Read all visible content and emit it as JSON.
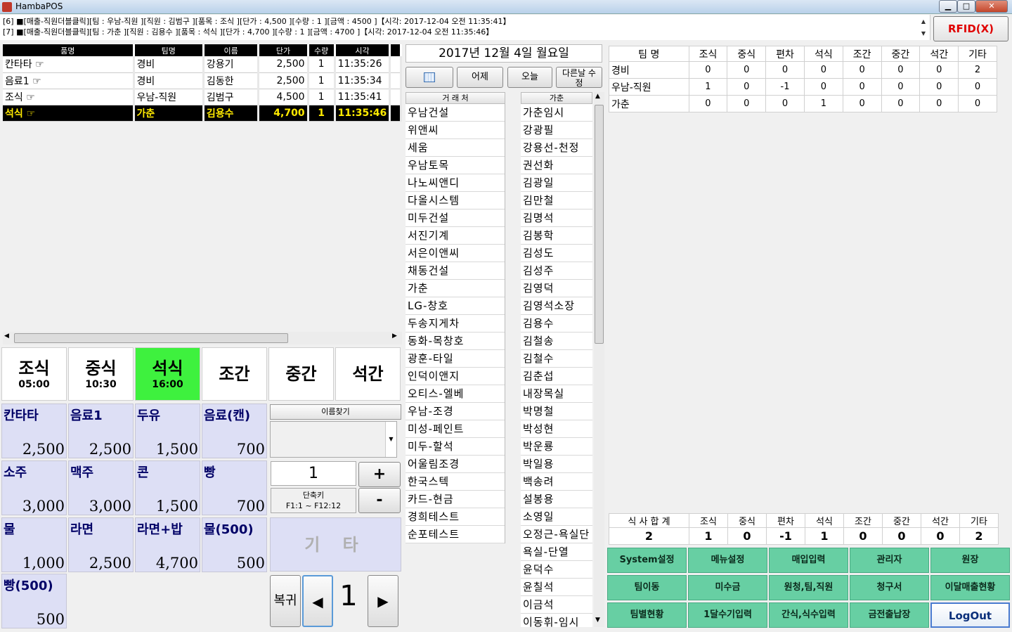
{
  "window": {
    "title": "HambaPOS",
    "buttons": [
      "▁",
      "□",
      "✕"
    ]
  },
  "log": {
    "lines": [
      "[6] ■[매출-직원더블클릭][팀 : 우남-직원 ][직원 : 김범구 ][품목 : 조식 ][단가 : 4,500 ][수량 : 1 ][금액 : 4500 ]【시각: 2017-12-04 오전 11:35:41】",
      "[7] ■[매출-직원더블클릭][팀 : 가춘 ][직원 : 김용수 ][품목 : 석식 ][단가 : 4,700 ][수량 : 1 ][금액 : 4700 ]【시각: 2017-12-04 오전 11:35:46】"
    ]
  },
  "rfid_label": "RFID(X)",
  "order_table": {
    "headers": [
      "품명",
      "팀명",
      "이름",
      "단가",
      "수량",
      "시각"
    ],
    "rows": [
      {
        "item": "칸타타 ☞",
        "team": "경비",
        "name": "강용기",
        "price": "2,500",
        "qty": "1",
        "time": "11:35:26"
      },
      {
        "item": "음료1 ☞",
        "team": "경비",
        "name": "김동한",
        "price": "2,500",
        "qty": "1",
        "time": "11:35:34"
      },
      {
        "item": "조식 ☞",
        "team": "우남-직원",
        "name": "김범구",
        "price": "4,500",
        "qty": "1",
        "time": "11:35:41"
      },
      {
        "item": "석식 ☞",
        "team": "가춘",
        "name": "김용수",
        "price": "4,700",
        "qty": "1",
        "time": "11:35:46"
      }
    ]
  },
  "meals": [
    {
      "name": "조식",
      "time": "05:00"
    },
    {
      "name": "중식",
      "time": "10:30"
    },
    {
      "name": "석식",
      "time": "16:00"
    },
    {
      "name": "조간",
      "time": ""
    },
    {
      "name": "중간",
      "time": ""
    },
    {
      "name": "석간",
      "time": ""
    }
  ],
  "menu_items": [
    {
      "name": "칸타타",
      "price": "2,500"
    },
    {
      "name": "음료1",
      "price": "2,500"
    },
    {
      "name": "두유",
      "price": "1,500"
    },
    {
      "name": "음료(캔)",
      "price": "700"
    },
    {
      "name": "소주",
      "price": "3,000"
    },
    {
      "name": "맥주",
      "price": "3,000"
    },
    {
      "name": "콘",
      "price": "1,500"
    },
    {
      "name": "빵",
      "price": "700"
    },
    {
      "name": "물",
      "price": "1,000"
    },
    {
      "name": "라면",
      "price": "2,500"
    },
    {
      "name": "라면+밥",
      "price": "4,700"
    },
    {
      "name": "물(500)",
      "price": "500"
    },
    {
      "name": "빵(500)",
      "price": "500"
    }
  ],
  "controls": {
    "etc": "기 타",
    "find_name": "이름찾기",
    "quantity": "1",
    "plus": "+",
    "minus": "-",
    "shortcut_title": "단축키",
    "shortcut_range": "F1:1 ~ F12:12",
    "return": "복귀",
    "prev": "◀",
    "next": "▶",
    "page": "1"
  },
  "date_panel": {
    "date": "2017년  12월  4일  월요일",
    "yesterday": "어제",
    "today": "오늘",
    "other_day": "다른날 수  정"
  },
  "clients": {
    "header": "거 래 처",
    "items": [
      "우남건설",
      "위앤씨",
      "세움",
      "우남토목",
      "나노씨앤디",
      "다올시스템",
      "미두건설",
      "서진기계",
      "서은이앤씨",
      "채동건설",
      "가춘",
      "LG-창호",
      "두송지게차",
      "동화-목창호",
      "광훈-타일",
      "인덕이앤지",
      "오티스-엘베",
      "우남-조경",
      "미성-페인트",
      "미두-할석",
      "어울림조경",
      "한국스텍",
      "카드-현금",
      "경희테스트",
      "순포테스트"
    ]
  },
  "employees": {
    "header": "가춘",
    "items": [
      "가춘임시",
      "강광필",
      "강용선-천정",
      "권선화",
      "김광일",
      "김만철",
      "김명석",
      "김봉학",
      "김성도",
      "김성주",
      "김영덕",
      "김영석소장",
      "김용수",
      "김철송",
      "김철수",
      "김춘섭",
      "내장목실",
      "박명철",
      "박성현",
      "박운룡",
      "박일용",
      "백송려",
      "설봉용",
      "소영일",
      "오정근-욕실단",
      "욕실-단열",
      "윤덕수",
      "윤칠석",
      "이금석",
      "이동휘-임시"
    ]
  },
  "team_stats": {
    "headers": [
      "팀 명",
      "조식",
      "중식",
      "편차",
      "석식",
      "조간",
      "중간",
      "석간",
      "기타"
    ],
    "rows": [
      [
        "경비",
        "0",
        "0",
        "0",
        "0",
        "0",
        "0",
        "0",
        "2"
      ],
      [
        "우남-직원",
        "1",
        "0",
        "-1",
        "0",
        "0",
        "0",
        "0",
        "0"
      ],
      [
        "가춘",
        "0",
        "0",
        "0",
        "1",
        "0",
        "0",
        "0",
        "0"
      ]
    ]
  },
  "totals": {
    "headers": [
      "식 사 합 계",
      "조식",
      "중식",
      "편차",
      "석식",
      "조간",
      "중간",
      "석간",
      "기타"
    ],
    "values": [
      "2",
      "1",
      "0",
      "-1",
      "1",
      "0",
      "0",
      "0",
      "2"
    ]
  },
  "admin_buttons": [
    "System설정",
    "메뉴설정",
    "매입입력",
    "관리자",
    "원장",
    "팀이동",
    "미수금",
    "원청,팀,직원",
    "청구서",
    "이달매출현황",
    "팀별현황",
    "1달수기입력",
    "간식,식수입력",
    "금전출납장",
    "LogOut"
  ],
  "colors": {
    "active_meal": "#3ef13e",
    "menu_bg": "#dddff5",
    "admin_btn": "#67cfa3",
    "rfid_text": "#e00000",
    "selected_row_text": "#ffea00"
  }
}
